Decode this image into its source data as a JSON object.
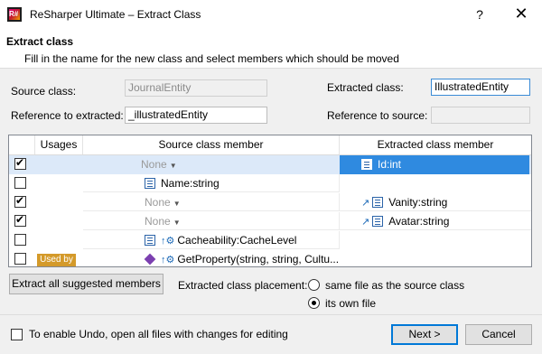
{
  "window": {
    "title": "ReSharper Ultimate – Extract Class",
    "help": "?",
    "close": "✕"
  },
  "header": {
    "title": "Extract class",
    "description": "Fill in the name for the new class and select members which should be moved"
  },
  "form": {
    "source_class_label": "Source class:",
    "source_class_value": "JournalEntity",
    "extracted_class_label": "Extracted class:",
    "extracted_class_value": "IllustratedEntity",
    "reference_to_extracted_label": "Reference to extracted:",
    "reference_to_extracted_value": "_illustratedEntity",
    "reference_to_source_label": "Reference to source:",
    "reference_to_source_value": ""
  },
  "grid": {
    "columns": {
      "usages": "Usages",
      "source": "Source class member",
      "extracted": "Extracted class member"
    },
    "rows": [
      {
        "checked": true,
        "used_by": "",
        "source": "None",
        "source_kind": "none",
        "extracted": "Id:int",
        "selected": true
      },
      {
        "checked": false,
        "used_by": "",
        "source": "Name:string",
        "source_kind": "property",
        "extracted": "",
        "selected": false
      },
      {
        "checked": true,
        "used_by": "",
        "source": "None",
        "source_kind": "none",
        "extracted": "Vanity:string",
        "selected": false
      },
      {
        "checked": true,
        "used_by": "",
        "source": "None",
        "source_kind": "none",
        "extracted": "Avatar:string",
        "selected": false
      },
      {
        "checked": false,
        "used_by": "",
        "source": "Cacheability:CacheLevel",
        "source_kind": "property-arrow",
        "extracted": "",
        "selected": false
      },
      {
        "checked": false,
        "used_by": "Used by",
        "source": "GetProperty(string, string, Cultu...",
        "source_kind": "method-arrow",
        "extracted": "",
        "selected": false
      }
    ]
  },
  "actions": {
    "extract_all_label": "Extract all suggested members",
    "placement_label": "Extracted class placement:",
    "placement_options": [
      "same file as the source class",
      "its own file"
    ],
    "placement_selected": "its own file"
  },
  "footer": {
    "undo_label": "To enable Undo, open all files with changes for editing",
    "undo_checked": false,
    "next_label": "Next >",
    "cancel_label": "Cancel"
  }
}
